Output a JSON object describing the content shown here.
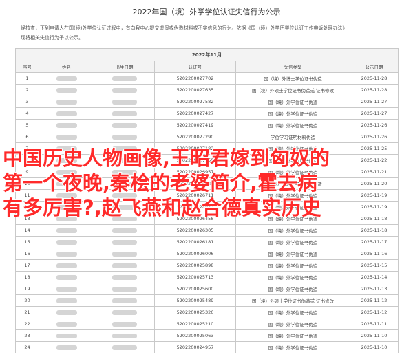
{
  "page": {
    "title": "2022年国（境）外学学位认证失信行为公示",
    "intro": [
      "经核查，下列申请人在国(境)外学位认证过程中，有向我中心提交虚假或伪造材料或不实信息的行为。依据《国（境）外学历学位认证工作申诉处理办法》",
      "现将相关失信行为予以公示。"
    ]
  },
  "table": {
    "caption": "2022年11月",
    "headers": [
      "序号",
      "姓名",
      "出生日期",
      "认证号",
      "失信类型",
      "公示日期"
    ],
    "rows": [
      {
        "seq": "1",
        "cert": "5202200027702",
        "type": "国（境）外博士学位证书伪造",
        "date": "2025-11-28"
      },
      {
        "seq": "2",
        "cert": "5202200027635",
        "type": "国（境）外硕士学位证书伪造或 证书修改",
        "date": "2025-11-28"
      },
      {
        "seq": "3",
        "cert": "5202200027582",
        "type": "国（境）外学位证书伪造",
        "date": "2025-11-27"
      },
      {
        "seq": "4",
        "cert": "5202200027427",
        "type": "国（境）外学位证书伪造",
        "date": "2025-11-27"
      },
      {
        "seq": "5",
        "cert": "5202200027419",
        "type": "国（境）外学位证书伪造",
        "date": "2025-11-26"
      },
      {
        "seq": "6",
        "cert": "5202200027290",
        "type": "学位学习证明材料伪造",
        "date": "2025-11-26"
      },
      {
        "seq": "7",
        "cert": "5202200027182",
        "type": "国（境）外学位证书伪造",
        "date": "2025-11-25"
      },
      {
        "seq": "8",
        "cert": "5202200027058",
        "type": "国（境）外学位证书伪造",
        "date": "2025-11-22"
      },
      {
        "seq": "9",
        "cert": "5202200026957",
        "type": "国（境）外学位证书伪造",
        "date": "2025-11-21"
      },
      {
        "seq": "10",
        "cert": "5202200026835",
        "type": "国（境）外硕士学位证书伪造",
        "date": "2025-11-20"
      },
      {
        "seq": "11",
        "cert": "5202200026711",
        "type": "国（境）外学位证书伪造",
        "date": "2025-11-19"
      },
      {
        "seq": "12",
        "cert": "5202200026623",
        "type": "国（境）外学位证书伪造",
        "date": "2025-11-19"
      },
      {
        "seq": "13",
        "cert": "5202200026458",
        "type": "国（境）外学位证书伪造",
        "date": "2025-11-18"
      },
      {
        "seq": "14",
        "cert": "5202200026305",
        "type": "国（境）外学位证书伪造",
        "date": "2025-11-18"
      },
      {
        "seq": "15",
        "cert": "5202200026181",
        "type": "国（境）外学位证书伪造",
        "date": "2025-11-17"
      },
      {
        "seq": "16",
        "cert": "5202200026006",
        "type": "国（境）外学位证书伪造",
        "date": "2025-11-16"
      },
      {
        "seq": "17",
        "cert": "5202200025898",
        "type": "国（境）外学位证书伪造",
        "date": "2025-11-15"
      },
      {
        "seq": "18",
        "cert": "5202200025713",
        "type": "国（境）外学位证书伪造",
        "date": "2025-11-14"
      },
      {
        "seq": "19",
        "cert": "5202200025600",
        "type": "国（境）外学位证书伪造",
        "date": "2025-11-13"
      },
      {
        "seq": "20",
        "cert": "5202200025489",
        "type": "国（境）外硕士学位证书伪造或 证书修改",
        "date": "2025-11-12"
      },
      {
        "seq": "21",
        "cert": "5202200025326",
        "type": "国（境）外学位证书伪造",
        "date": "2025-11-12"
      },
      {
        "seq": "22",
        "cert": "5202200025210",
        "type": "国（境）外学位证书伪造",
        "date": "2025-11-11"
      },
      {
        "seq": "23",
        "cert": "5202200025063",
        "type": "国（境）外学位证书伪造",
        "date": "2025-11-10"
      },
      {
        "seq": "24",
        "cert": "5202200024957",
        "type": "国（境）外学位证书伪造",
        "date": "2025-11-10"
      }
    ]
  },
  "overlay": {
    "lines": [
      "中国历史人物画像,王昭君嫁到匈奴的",
      "第一个夜晚,秦桧的老婆简介,霍去病",
      "有多厉害?,赵飞燕和赵合德真实历史"
    ],
    "color": "#ff2a2a"
  }
}
